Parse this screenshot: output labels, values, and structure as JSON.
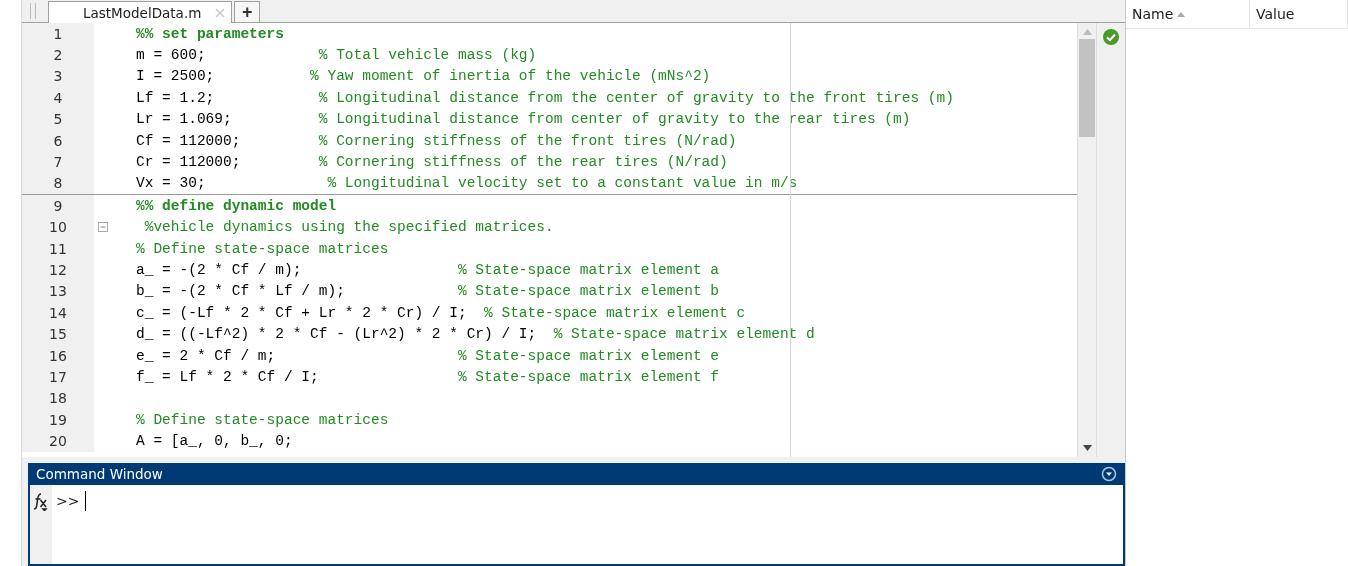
{
  "editor": {
    "tabs": [
      {
        "title": "LastModelData.m",
        "selected": true
      }
    ],
    "new_tab": "+",
    "lines": [
      {
        "number": "1",
        "kind": "section",
        "code": "%% set parameters"
      },
      {
        "number": "2",
        "kind": "code",
        "code": "m = 600;             ",
        "comment": "% Total vehicle mass (kg)"
      },
      {
        "number": "3",
        "kind": "code",
        "code": "I = 2500;           ",
        "comment": "% Yaw moment of inertia of the vehicle (mNs^2)"
      },
      {
        "number": "4",
        "kind": "code",
        "code": "Lf = 1.2;            ",
        "comment": "% Longitudinal distance from the center of gravity to the front tires (m)"
      },
      {
        "number": "5",
        "kind": "code",
        "code": "Lr = 1.069;          ",
        "comment": "% Longitudinal distance from center of gravity to the rear tires (m)"
      },
      {
        "number": "6",
        "kind": "code",
        "code": "Cf = 112000;         ",
        "comment": "% Cornering stiffness of the front tires (N/rad)"
      },
      {
        "number": "7",
        "kind": "code",
        "code": "Cr = 112000;         ",
        "comment": "% Cornering stiffness of the rear tires (N/rad)"
      },
      {
        "number": "8",
        "kind": "code",
        "code": "Vx = 30;              ",
        "comment": "% Longitudinal velocity set to a constant value in m/s"
      },
      {
        "number": "9",
        "kind": "section",
        "code": "%% define dynamic model"
      },
      {
        "number": "10",
        "kind": "comment",
        "code": " %vehicle dynamics using the specified matrices.",
        "fold": true
      },
      {
        "number": "11",
        "kind": "comment",
        "code": "% Define state-space matrices"
      },
      {
        "number": "12",
        "kind": "code",
        "code": "a_ = -(2 * Cf / m);                  ",
        "comment": "% State-space matrix element a"
      },
      {
        "number": "13",
        "kind": "code",
        "code": "b_ = -(2 * Cf * Lf / m);             ",
        "comment": "% State-space matrix element b"
      },
      {
        "number": "14",
        "kind": "code",
        "code": "c_ = (-Lf * 2 * Cf + Lr * 2 * Cr) / I;  ",
        "comment": "% State-space matrix element c"
      },
      {
        "number": "15",
        "kind": "code",
        "code": "d_ = ((-Lf^2) * 2 * Cf - (Lr^2) * 2 * Cr) / I;  ",
        "comment": "% State-space matrix element d"
      },
      {
        "number": "16",
        "kind": "code",
        "code": "e_ = 2 * Cf / m;                     ",
        "comment": "% State-space matrix element e"
      },
      {
        "number": "17",
        "kind": "code",
        "code": "f_ = Lf * 2 * Cf / I;                ",
        "comment": "% State-space matrix element f"
      },
      {
        "number": "18",
        "kind": "blank"
      },
      {
        "number": "19",
        "kind": "comment",
        "code": "% Define state-space matrices"
      },
      {
        "number": "20",
        "kind": "code",
        "code": "A = [a_, 0, b_, 0;"
      }
    ]
  },
  "command_window": {
    "title": "Command Window",
    "prompt": ">>"
  },
  "workspace": {
    "columns": [
      {
        "label": "Name",
        "sorted": true
      },
      {
        "label": "Value",
        "sorted": false
      }
    ]
  }
}
